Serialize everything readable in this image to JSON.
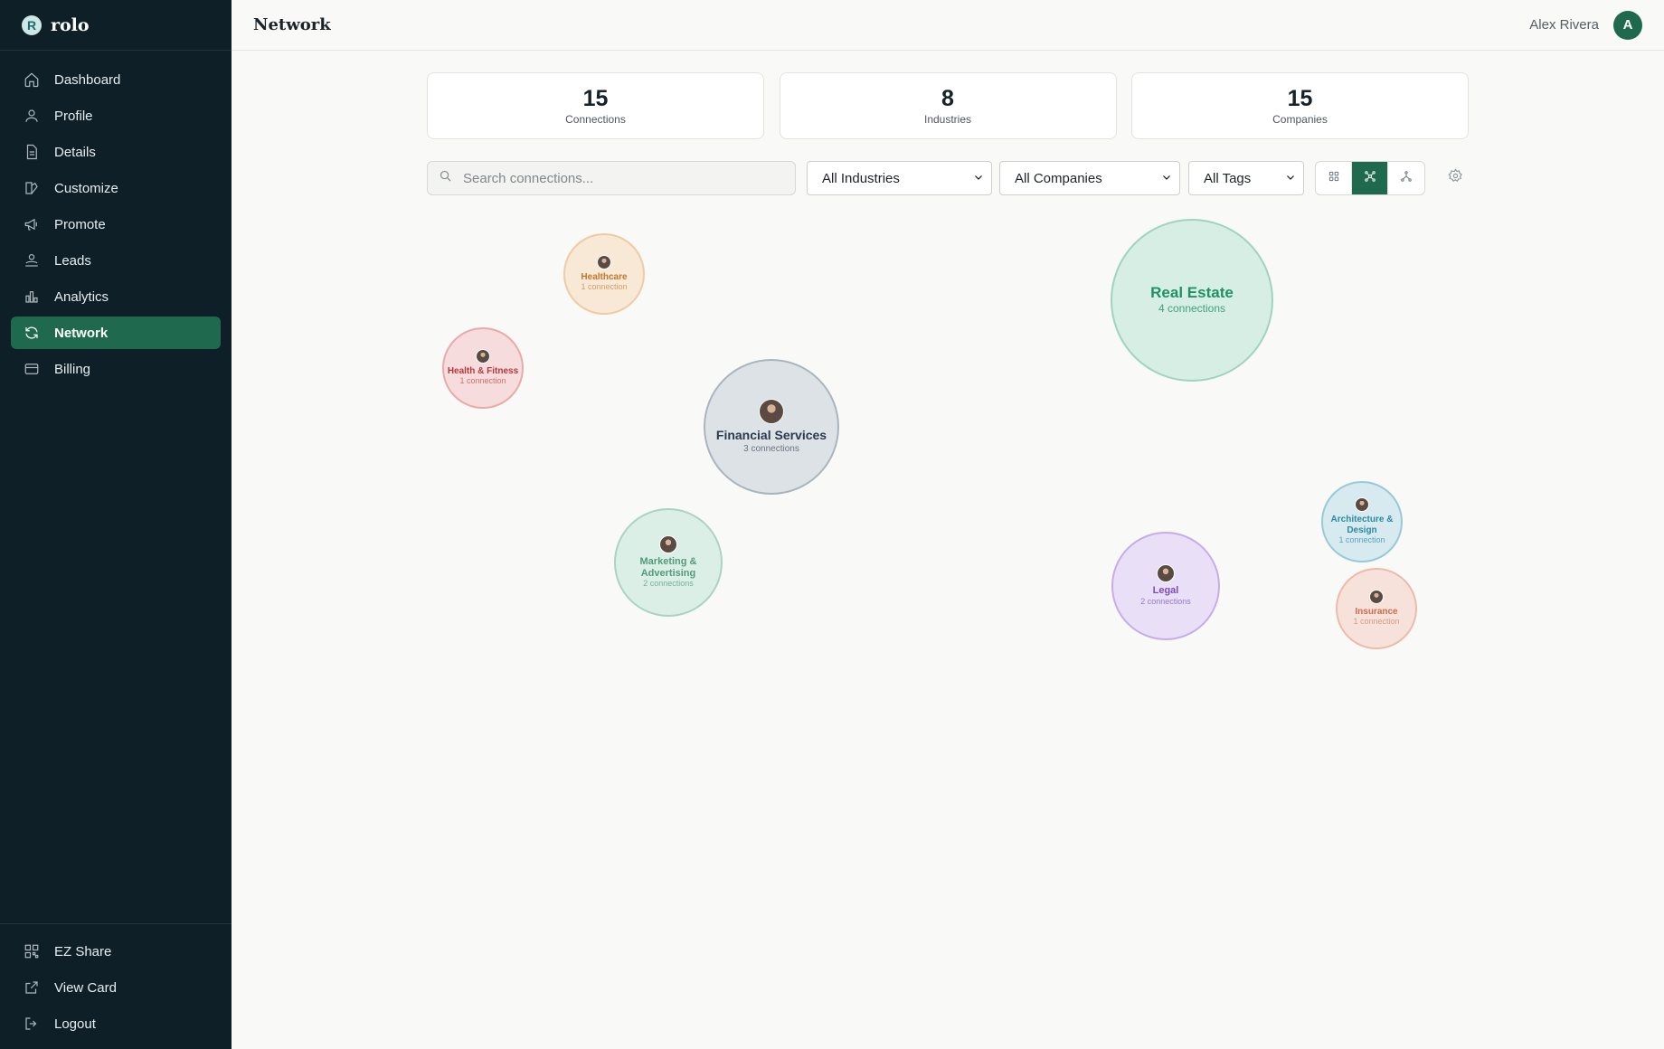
{
  "app": {
    "logo_letter": "R",
    "name": "rolo"
  },
  "sidebar": {
    "items": [
      {
        "label": "Dashboard",
        "icon": "home-icon"
      },
      {
        "label": "Profile",
        "icon": "user-icon"
      },
      {
        "label": "Details",
        "icon": "document-icon"
      },
      {
        "label": "Customize",
        "icon": "palette-icon"
      },
      {
        "label": "Promote",
        "icon": "megaphone-icon"
      },
      {
        "label": "Leads",
        "icon": "leads-icon"
      },
      {
        "label": "Analytics",
        "icon": "bar-chart-icon"
      },
      {
        "label": "Network",
        "icon": "refresh-icon",
        "active": true
      },
      {
        "label": "Billing",
        "icon": "credit-card-icon"
      }
    ],
    "bottom_items": [
      {
        "label": "EZ Share",
        "icon": "qr-code-icon"
      },
      {
        "label": "View Card",
        "icon": "external-link-icon"
      },
      {
        "label": "Logout",
        "icon": "logout-icon"
      }
    ]
  },
  "header": {
    "title": "Network",
    "user_name": "Alex Rivera",
    "avatar_initial": "A"
  },
  "stats": [
    {
      "value": "15",
      "label": "Connections"
    },
    {
      "value": "8",
      "label": "Industries"
    },
    {
      "value": "15",
      "label": "Companies"
    }
  ],
  "filters": {
    "search_placeholder": "Search connections...",
    "industry": "All Industries",
    "company": "All Companies",
    "tag": "All Tags",
    "view_modes": [
      "grid-view-icon",
      "cluster-view-icon",
      "tree-view-icon"
    ],
    "active_view": "cluster-view-icon"
  },
  "accent_color": "#1f6a4f",
  "clusters": [
    {
      "name": "Healthcare",
      "count": "1 connection",
      "color": "#c4762b"
    },
    {
      "name": "Health & Fitness",
      "count": "1 connection",
      "color": "#b8363b"
    },
    {
      "name": "Financial Services",
      "count": "3 connections",
      "color": "#2a3a4e"
    },
    {
      "name": "Marketing & Advertising",
      "count": "2 connections",
      "color": "#4f9b7a"
    },
    {
      "name": "Real Estate",
      "count": "4 connections",
      "color": "#1f9265"
    },
    {
      "name": "Architecture & Design",
      "count": "1 connection",
      "color": "#2b8aa3"
    },
    {
      "name": "Legal",
      "count": "2 connections",
      "color": "#7c4cbb"
    },
    {
      "name": "Insurance",
      "count": "1 connection",
      "color": "#d16a48"
    }
  ]
}
